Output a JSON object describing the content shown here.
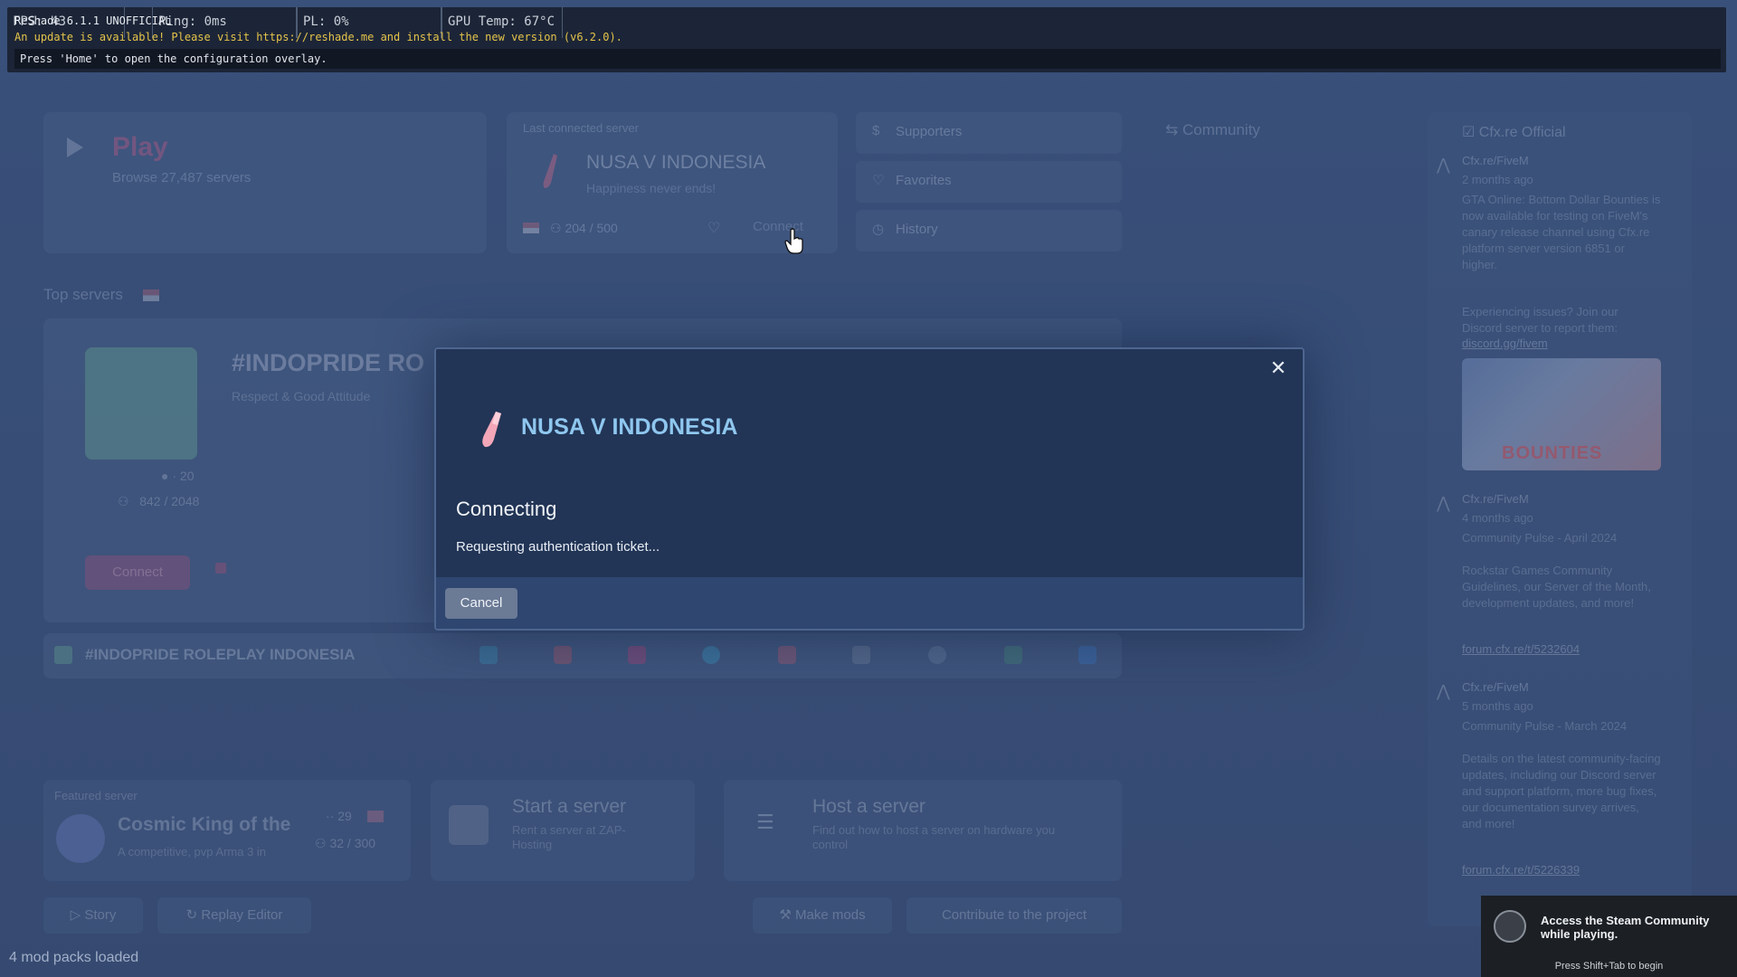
{
  "reshade": {
    "fps": "FPS: 43",
    "ping": "Ping: 0ms",
    "pl": "PL: 0%",
    "gpu_temp": "GPU Temp: 67°C",
    "version": "ReShade 6.1.1 UNOFFICIAL",
    "update_notice": "An update is available! Please visit https://reshade.me and install the new version (v6.2.0).",
    "help": "Press 'Home' to open the configuration overlay."
  },
  "play": {
    "title": "Play",
    "subtitle": "Browse 27,487 servers"
  },
  "last_server": {
    "caption": "Last connected server",
    "name": "NUSA V INDONESIA",
    "tagline": "Happiness never ends!",
    "players": "204 / 500",
    "connect_label": "Connect"
  },
  "side_buttons": [
    {
      "label": "Supporters",
      "icon": "dollar-icon"
    },
    {
      "label": "Favorites",
      "icon": "heart-icon"
    },
    {
      "label": "History",
      "icon": "clock-icon"
    }
  ],
  "community_tab": "Community",
  "news": {
    "title": "Cfx.re Official",
    "items": [
      {
        "author": "Cfx.re/FiveM",
        "time": "2 months ago",
        "body": "GTA Online: Bottom Dollar Bounties is now available for testing on FiveM's canary release channel using Cfx.re platform server version 6851 or higher.",
        "extra": "Experiencing issues? Join our Discord server to report them:",
        "link": "discord.gg/fivem",
        "image_text": "BOUNTIES"
      },
      {
        "author": "Cfx.re/FiveM",
        "time": "4 months ago",
        "body": "Community Pulse - April 2024",
        "extra": "Rockstar Games Community Guidelines, our Server of the Month, development updates, and more!",
        "link": "forum.cfx.re/t/5232604"
      },
      {
        "author": "Cfx.re/FiveM",
        "time": "5 months ago",
        "body": "Community Pulse - March 2024",
        "extra": "Details on the latest community-facing updates, including our Discord server and support platform, more bug fixes, our documentation survey arrives, and more!",
        "link": "forum.cfx.re/t/5226339"
      }
    ]
  },
  "top_servers": {
    "label": "Top servers",
    "featured_name": "#INDOPRIDE RO",
    "featured_desc": "Respect & Good Attitude",
    "stat_ping": "20",
    "stat_players": "842 / 2048",
    "connect_label": "Connect",
    "ticker_name": "#INDOPRIDE ROLEPLAY INDONESIA"
  },
  "featured_server": {
    "caption": "Featured server",
    "name": "Cosmic King of the",
    "desc": "A competitive, pvp Arma 3 in",
    "ping": "29",
    "players": "32 / 300"
  },
  "start_server": {
    "title": "Start a server",
    "desc": "Rent a server at ZAP-Hosting"
  },
  "host_server": {
    "title": "Host a server",
    "desc": "Find out how to host a server on hardware you control"
  },
  "footer_buttons": {
    "story": "Story",
    "replay": "Replay Editor",
    "mods": "Make mods",
    "contribute": "Contribute to the project"
  },
  "mod_packs": "4 mod packs loaded",
  "modal": {
    "server_name": "NUSA V INDONESIA",
    "heading": "Connecting",
    "status": "Requesting authentication ticket...",
    "cancel_label": "Cancel",
    "close_glyph": "✕"
  },
  "steam": {
    "message": "Access the Steam Community while playing.",
    "hint": "Press Shift+Tab to begin"
  }
}
